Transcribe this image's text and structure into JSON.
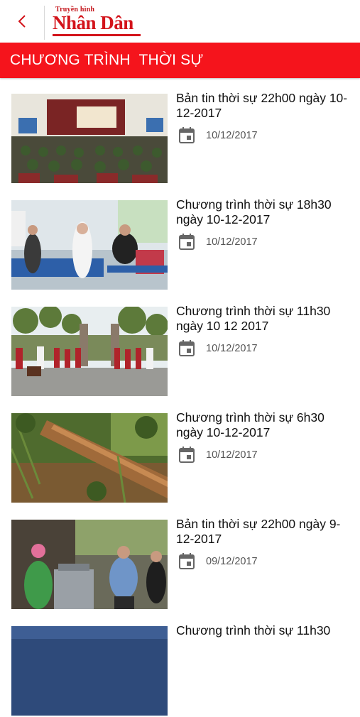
{
  "header": {
    "back_icon": "chevron-left-icon",
    "logo_small": "Truyền hình",
    "logo_big": "Nhân Dân",
    "brand_color": "#d3141b"
  },
  "section": {
    "title": "CHƯƠNG TRÌNH  THỜI SỰ",
    "bar_color": "#f5141c"
  },
  "items": [
    {
      "title": "Bản tin thời sự 22h00 ngày 10-12-2017",
      "date": "10/12/2017",
      "date_icon": "calendar-icon"
    },
    {
      "title": "Chương trình thời sự 18h30 ngày 10-12-2017",
      "date": "10/12/2017",
      "date_icon": "calendar-icon"
    },
    {
      "title": "Chương trình thời sự 11h30 ngày 10 12 2017",
      "date": "10/12/2017",
      "date_icon": "calendar-icon"
    },
    {
      "title": "Chương trình thời sự 6h30 ngày 10-12-2017",
      "date": "10/12/2017",
      "date_icon": "calendar-icon"
    },
    {
      "title": "Bản tin thời sự 22h00 ngày 9-12-2017",
      "date": "09/12/2017",
      "date_icon": "calendar-icon"
    },
    {
      "title": "Chương trình thời sự 11h30",
      "date": "",
      "date_icon": "calendar-icon"
    }
  ]
}
